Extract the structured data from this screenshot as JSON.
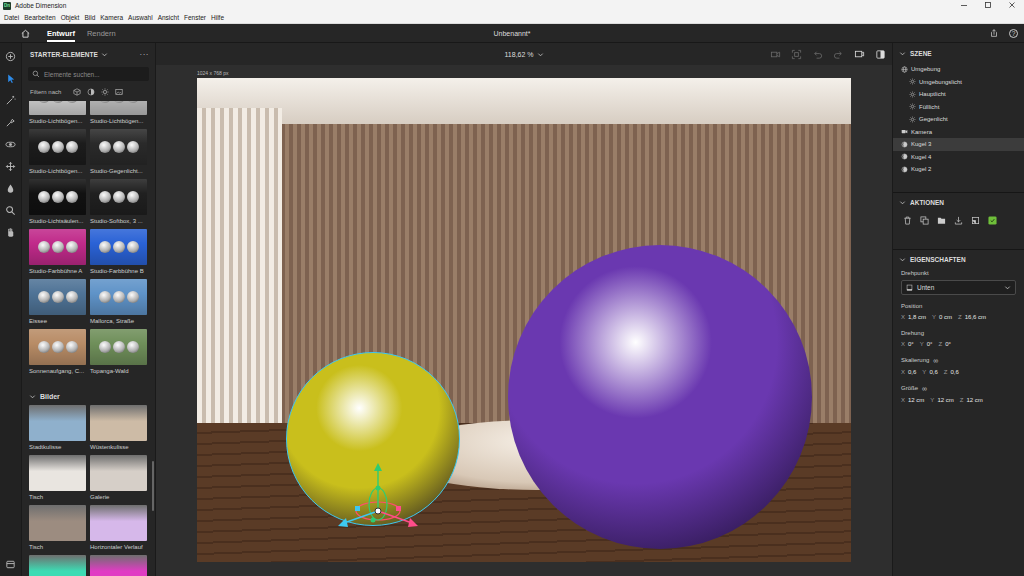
{
  "window": {
    "logo": "Dn",
    "title": "Adobe Dimension"
  },
  "menu": [
    "Datei",
    "Bearbeiten",
    "Objekt",
    "Bild",
    "Kamera",
    "Auswahl",
    "Ansicht",
    "Fenster",
    "Hilfe"
  ],
  "header": {
    "tabs": [
      {
        "label": "Entwurf",
        "selected": true
      },
      {
        "label": "Rendern",
        "selected": false
      }
    ],
    "document": "Unbenannt*",
    "help": "?"
  },
  "tools": [
    {
      "kind": "add",
      "selected": false
    },
    {
      "kind": "select",
      "selected": true
    },
    {
      "kind": "wand",
      "selected": false
    },
    {
      "kind": "paint",
      "selected": false
    },
    {
      "kind": "orbit",
      "selected": false
    },
    {
      "kind": "pan",
      "selected": false
    },
    {
      "kind": "dolly",
      "selected": false
    },
    {
      "kind": "zoom",
      "selected": false
    },
    {
      "kind": "hand",
      "selected": false
    },
    {
      "kind": "layers",
      "selected": false
    }
  ],
  "assets": {
    "title": "STARTER-ELEMENTE",
    "more": "···",
    "search_placeholder": "Elemente suchen...",
    "filter_label": "Filtern nach",
    "filters": [
      {
        "kind": "model"
      },
      {
        "kind": "material"
      },
      {
        "kind": "light"
      },
      {
        "kind": "image"
      }
    ],
    "lights": [
      {
        "label": "Studio-Lichtbögen...",
        "color": "#cfcfcf"
      },
      {
        "label": "Studio-Lichtbögen...",
        "color": "#bdbdbd"
      },
      {
        "label": "Studio-Lichtbögen...",
        "color": "#1c1c1c"
      },
      {
        "label": "Studio-Gegenlicht...",
        "color": "#2a2a2a"
      },
      {
        "label": "Studio-Lichtsäulen...",
        "color": "#111111"
      },
      {
        "label": "Studio-Softbox, 3 ...",
        "color": "#202020"
      },
      {
        "label": "Studio-Farbbühne A",
        "color": "#c02a8a"
      },
      {
        "label": "Studio-Farbbühne B",
        "color": "#2a62d6"
      },
      {
        "label": "Eissee",
        "color": "#4f7396"
      },
      {
        "label": "Mallorca, Straße",
        "color": "#5f93c8"
      },
      {
        "label": "Sonnenaufgang, C...",
        "color": "#b88c66"
      },
      {
        "label": "Topanga-Wald",
        "color": "#6f8f5a"
      }
    ],
    "images": {
      "title": "Bilder",
      "expanded": true,
      "items": [
        {
          "label": "Stadtkulisse",
          "color": "#8fb0cc"
        },
        {
          "label": "Wüstenkulisse",
          "color": "#cdbba6"
        },
        {
          "label": "Tisch",
          "color": "#e9e5e0"
        },
        {
          "label": "Galerie",
          "color": "#d6cfc8"
        },
        {
          "label": "Tisch",
          "color": "#9c8c80"
        },
        {
          "label": "Horizontaler Verlauf",
          "color": "#d6b8ea"
        },
        {
          "color": "#3ddcb4"
        },
        {
          "color": "#e03cc4"
        }
      ]
    }
  },
  "viewport": {
    "zoom": "118,62 %",
    "size_label": "1024 x 768 px",
    "tools": [
      {
        "kind": "camera",
        "disabled": true
      },
      {
        "kind": "frame",
        "disabled": true
      },
      {
        "kind": "undo",
        "disabled": true
      },
      {
        "kind": "redo",
        "disabled": true
      },
      {
        "kind": "bookmark",
        "disabled": false
      },
      {
        "kind": "panel",
        "disabled": false
      }
    ],
    "spheres": [
      {
        "color": "#c9bf1c",
        "selected": true
      },
      {
        "color": "#6a38b0",
        "selected": false
      }
    ]
  },
  "scene": {
    "title": "SZENE",
    "expanded": true,
    "items": [
      {
        "label": "Umgebung",
        "kind": "environment",
        "child": false,
        "selected": false
      },
      {
        "label": "Umgebungslicht",
        "kind": "light",
        "child": true,
        "selected": false
      },
      {
        "label": "Hauptlicht",
        "kind": "light",
        "child": true,
        "selected": false
      },
      {
        "label": "Fülllicht",
        "kind": "light",
        "child": true,
        "selected": false
      },
      {
        "label": "Gegenlicht",
        "kind": "light",
        "child": true,
        "selected": false
      },
      {
        "label": "Kamera",
        "kind": "camera",
        "child": false,
        "selected": false
      },
      {
        "label": "Kugel 3",
        "kind": "sphere",
        "child": false,
        "selected": true
      },
      {
        "label": "Kugel 4",
        "kind": "sphere",
        "child": false,
        "selected": false
      },
      {
        "label": "Kugel 2",
        "kind": "sphere",
        "child": false,
        "selected": false
      }
    ]
  },
  "actions": {
    "title": "AKTIONEN",
    "expanded": true,
    "items": [
      {
        "kind": "delete"
      },
      {
        "kind": "duplicate"
      },
      {
        "kind": "group"
      },
      {
        "kind": "export"
      },
      {
        "kind": "align"
      },
      {
        "kind": "publish"
      }
    ]
  },
  "properties": {
    "title": "EIGENSCHAFTEN",
    "expanded": true,
    "pivot": {
      "label": "Drehpunkt",
      "value": "Unten"
    },
    "groups": [
      {
        "label": "Position",
        "fields": [
          {
            "axis": "X",
            "value": "1,8 cm"
          },
          {
            "axis": "Y",
            "value": "0 cm"
          },
          {
            "axis": "Z",
            "value": "16,6 cm"
          }
        ]
      },
      {
        "label": "Drehung",
        "fields": [
          {
            "axis": "X",
            "value": "0°"
          },
          {
            "axis": "Y",
            "value": "0°"
          },
          {
            "axis": "Z",
            "value": "0°"
          }
        ]
      },
      {
        "label": "Skalierung",
        "link": "∞",
        "fields": [
          {
            "axis": "X",
            "value": "0,6"
          },
          {
            "axis": "Y",
            "value": "0,6"
          },
          {
            "axis": "Z",
            "value": "0,6"
          }
        ]
      },
      {
        "label": "Größe",
        "link": "∞",
        "fields": [
          {
            "axis": "X",
            "value": "12 cm"
          },
          {
            "axis": "Y",
            "value": "12 cm"
          },
          {
            "axis": "Z",
            "value": "12 cm"
          }
        ]
      }
    ]
  }
}
